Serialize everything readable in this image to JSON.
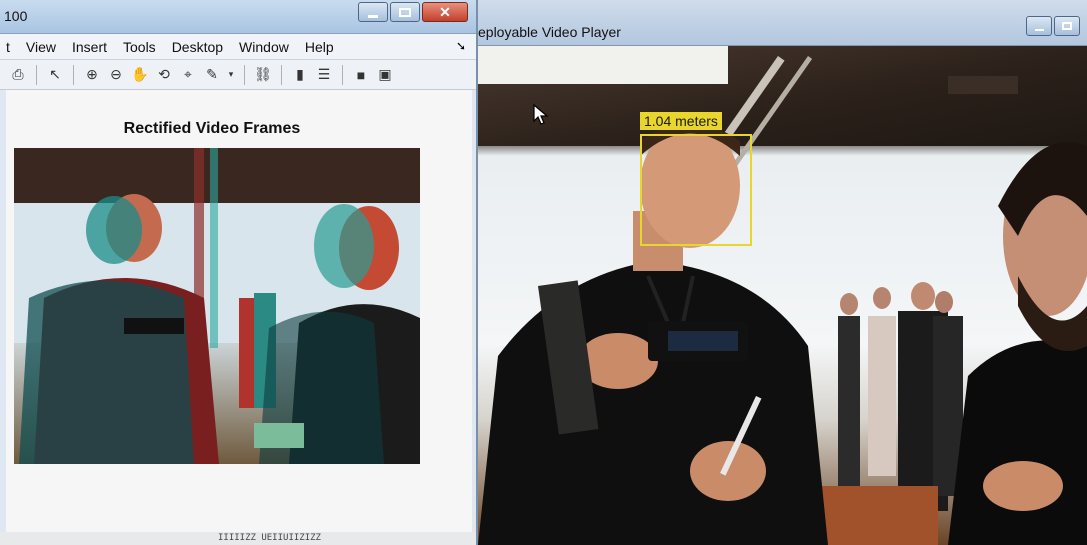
{
  "left_window": {
    "title_fragment": "100",
    "menu": [
      "t",
      "View",
      "Insert",
      "Tools",
      "Desktop",
      "Window",
      "Help"
    ],
    "figure_title": "Rectified Video Frames",
    "bottom_text": "IIIIIZZ UEIIUIIZIZZ"
  },
  "right_window": {
    "title": "eployable Video Player",
    "detection_label": "1.04 meters",
    "detection_color": "#e8d62c"
  },
  "icons": [
    "print-icon",
    "arrow-pointer-icon",
    "zoom-in-icon",
    "zoom-out-icon",
    "pan-hand-icon",
    "rotate-icon",
    "data-cursor-icon",
    "brush-icon",
    "link-icon",
    "colorbar-icon",
    "legend-icon",
    "hide-plot-tools-icon",
    "show-plot-tools-icon"
  ]
}
